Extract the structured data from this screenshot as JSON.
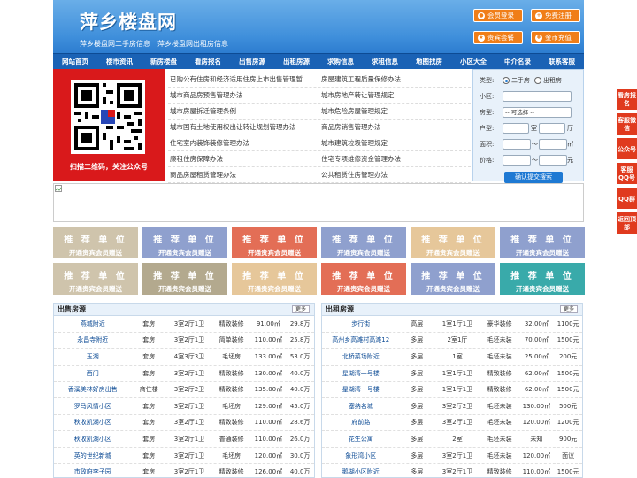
{
  "header": {
    "logo": "萍乡楼盘网",
    "subtitle": "萍乡楼盘网二手房信息　萍乡楼盘网出租房信息",
    "buttons": [
      {
        "label": "会员登录"
      },
      {
        "label": "免费注册"
      },
      {
        "label": "贵宾套餐"
      },
      {
        "label": "金币充值"
      }
    ]
  },
  "nav": [
    "网站首页",
    "楼市资讯",
    "新房楼盘",
    "看房报名",
    "出售房源",
    "出租房源",
    "求购信息",
    "求租信息",
    "地图找房",
    "小区大全",
    "中介名录",
    "联系客服"
  ],
  "qr": {
    "caption": "扫描二维码，关注公众号"
  },
  "links": [
    [
      "已购公有住房和经济适用住房上市出售管理暂",
      "房屋建筑工程质量保修办法"
    ],
    [
      "城市商品房预售管理办法",
      "城市房地产转让管理规定"
    ],
    [
      "城市房屋拆迁管理条例",
      "城市危险房屋管理规定"
    ],
    [
      "城市国有土地使用权出让转让规划管理办法",
      "商品房销售管理办法"
    ],
    [
      "住宅室内装饰装修管理办法",
      "城市建筑垃圾管理规定"
    ],
    [
      "廉租住房保障办法",
      "住宅专项维修资金管理办法"
    ],
    [
      "商品房屋租赁管理办法",
      "公共租赁住房管理办法"
    ]
  ],
  "search": {
    "type_label": "类型:",
    "opt1": "二手房",
    "opt2": "出租房",
    "estate_label": "小区:",
    "house_label": "房型:",
    "house_select": "-- 可选择 --",
    "layout_label": "户型:",
    "room": "室",
    "hall": "厅",
    "area_label": "面积:",
    "area_unit": "㎡",
    "price_label": "价格:",
    "price_unit": "元",
    "submit": "确认提交搜索"
  },
  "rec": {
    "title": "推 荐 单 位",
    "sub": "开通贵宾会员赠送",
    "colors": [
      "#cfc4ac",
      "#8fa0ce",
      "#e36e56",
      "#8fa0ce",
      "#e6c79a",
      "#8fa0ce",
      "#cfc4ac",
      "#b3a98e",
      "#e6c79a",
      "#e36e56",
      "#8fa0ce",
      "#39aaaa"
    ]
  },
  "sale": {
    "title": "出售房源",
    "more": "更多",
    "rows": [
      [
        "燕城附近",
        "套房",
        "3室2厅1卫",
        "精致装修",
        "91.00㎡",
        "29.8万"
      ],
      [
        "永昌寺附近",
        "套房",
        "3室2厅1卫",
        "简单装修",
        "110.00㎡",
        "25.8万"
      ],
      [
        "玉湖",
        "套房",
        "4室3厅3卫",
        "毛坯房",
        "133.00㎡",
        "53.0万"
      ],
      [
        "西门",
        "套房",
        "3室2厅1卫",
        "精致装修",
        "130.00㎡",
        "40.0万"
      ],
      [
        "香溪美林好房出售",
        "商住楼",
        "3室2厅2卫",
        "精致装修",
        "135.00㎡",
        "40.0万"
      ],
      [
        "罗马风情小区",
        "套房",
        "3室2厅1卫",
        "毛坯房",
        "129.00㎡",
        "45.0万"
      ],
      [
        "秋收凯湖小区",
        "套房",
        "3室2厅1卫",
        "精致装修",
        "110.00㎡",
        "28.6万"
      ],
      [
        "秋收凯湖小区",
        "套房",
        "3室2厅1卫",
        "普通装修",
        "110.00㎡",
        "26.0万"
      ],
      [
        "英的世纪新城",
        "套房",
        "3室2厅1卫",
        "毛坯房",
        "120.00㎡",
        "30.0万"
      ],
      [
        "市政府李子园",
        "套房",
        "3室2厅1卫",
        "精致装修",
        "126.00㎡",
        "40.0万"
      ]
    ]
  },
  "rent": {
    "title": "出租房源",
    "more": "更多",
    "rows": [
      [
        "步行街",
        "高层",
        "1室1厅1卫",
        "豪华装修",
        "32.00㎡",
        "1100元"
      ],
      [
        "高州乡高滩村高滩12",
        "多层",
        "2室1厅",
        "毛坯未装",
        "70.00㎡",
        "1500元"
      ],
      [
        "北桥菜场附近",
        "多层",
        "1室",
        "毛坯未装",
        "25.00㎡",
        "200元"
      ],
      [
        "星湖湾一号楼",
        "多层",
        "1室1厅1卫",
        "精致装修",
        "62.00㎡",
        "1500元"
      ],
      [
        "星湖湾一号楼",
        "多层",
        "1室1厅1卫",
        "精致装修",
        "62.00㎡",
        "1500元"
      ],
      [
        "塞纳名城",
        "多层",
        "3室2厅2卫",
        "毛坯未装",
        "130.00㎡",
        "500元"
      ],
      [
        "府前路",
        "多层",
        "3室2厅1卫",
        "毛坯未装",
        "120.00㎡",
        "1200元"
      ],
      [
        "花生公寓",
        "多层",
        "2室",
        "毛坯未装",
        "未知",
        "900元"
      ],
      [
        "象形湾小区",
        "多层",
        "3室2厅1卫",
        "毛坯未装",
        "120.00㎡",
        "面议"
      ],
      [
        "鹅湖小区附近",
        "多层",
        "3室2厅1卫",
        "精致装修",
        "110.00㎡",
        "1500元"
      ]
    ]
  },
  "side": [
    "看房报名",
    "客服微信",
    "公众号",
    "客服QQ号",
    "QQ群",
    "返回顶部"
  ]
}
